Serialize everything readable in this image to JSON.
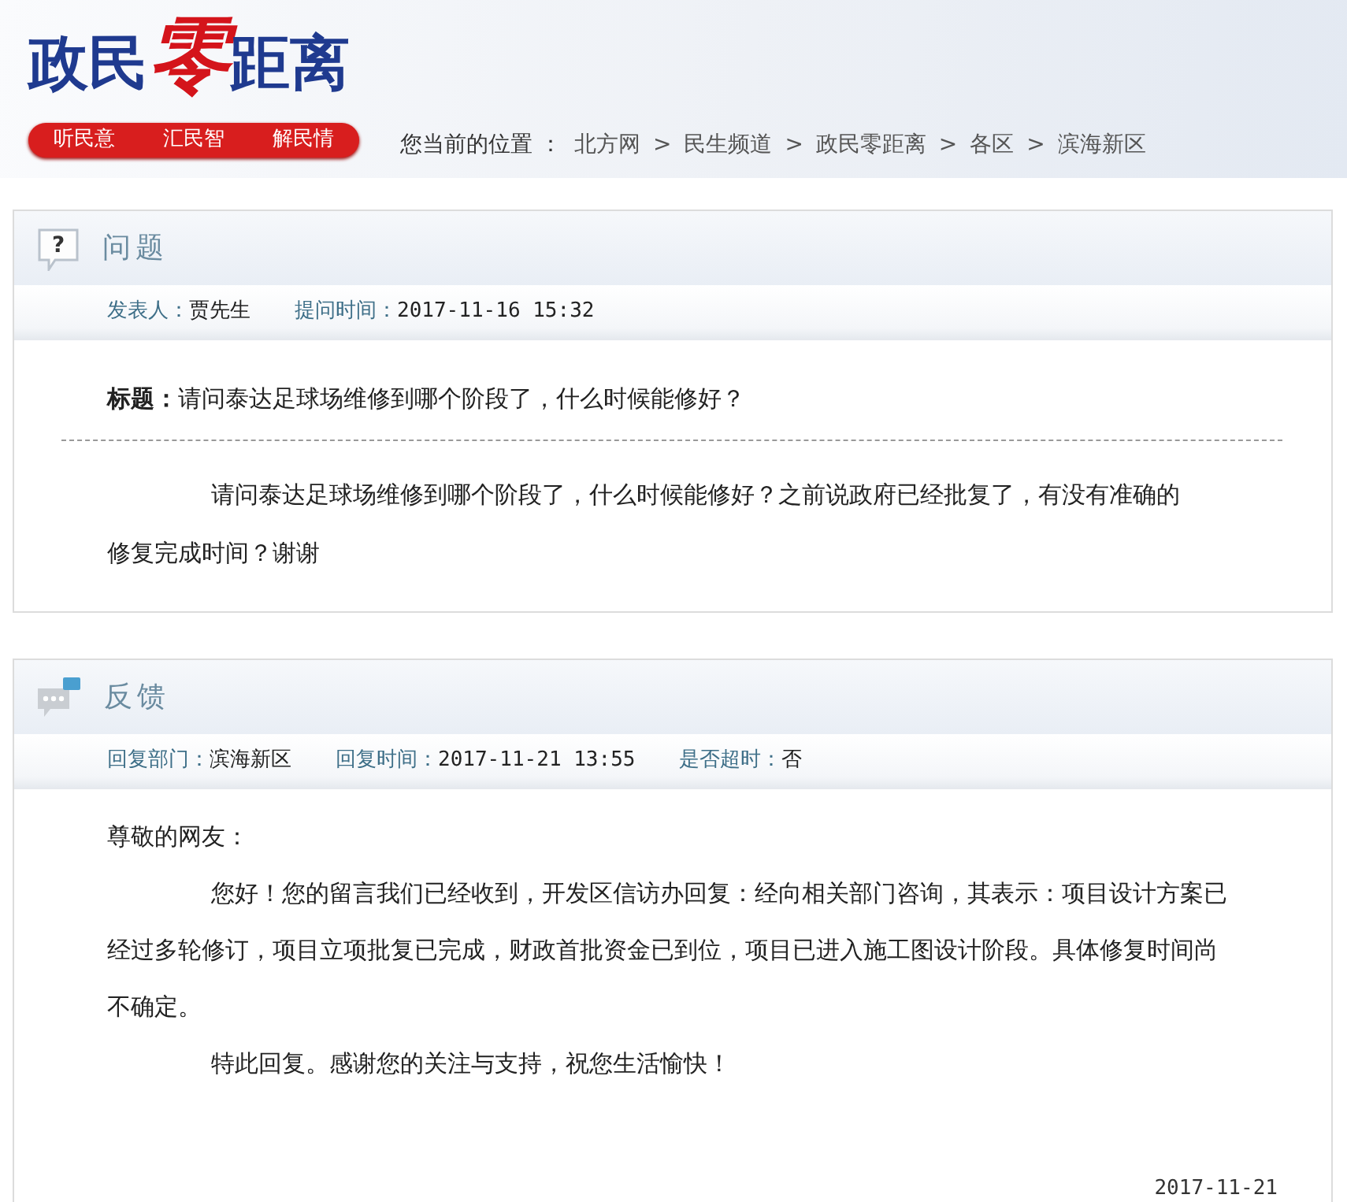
{
  "header": {
    "logo": [
      "政民",
      "零",
      "距离"
    ],
    "slogans": [
      "听民意",
      "汇民智",
      "解民情"
    ],
    "breadcrumb": {
      "label": "您当前的位置 ：",
      "separator": ">",
      "items": [
        "北方网",
        "民生频道",
        "政民零距离",
        "各区",
        "滨海新区"
      ]
    }
  },
  "question": {
    "icon_glyph": "?",
    "heading": "问题",
    "meta": [
      {
        "label": "发表人：",
        "value": "贾先生"
      },
      {
        "label": "提问时间：",
        "value": "2017-11-16 15:32"
      }
    ],
    "subject_label": "标题：",
    "subject": "请问泰达足球场维修到哪个阶段了，什么时候能修好？",
    "paragraphs": [
      "请问泰达足球场维修到哪个阶段了，什么时候能修好？之前说政府已经批复了，有没有准确的修复完成时间？谢谢"
    ]
  },
  "feedback": {
    "heading": "反馈",
    "meta": [
      {
        "label": "回复部门：",
        "value": "滨海新区"
      },
      {
        "label": "回复时间：",
        "value": "2017-11-21 13:55"
      },
      {
        "label": "是否超时：",
        "value": "否"
      }
    ],
    "greeting": "尊敬的网友：",
    "paragraphs": [
      "您好！您的留言我们已经收到，开发区信访办回复：经向相关部门咨询，其表示：项目设计方案已经过多轮修订，项目立项批复已完成，财政首批资金已到位，项目已进入施工图设计阶段。具体修复时间尚不确定。",
      "特此回复。感谢您的关注与支持，祝您生活愉快！"
    ],
    "date": "2017-11-21"
  }
}
